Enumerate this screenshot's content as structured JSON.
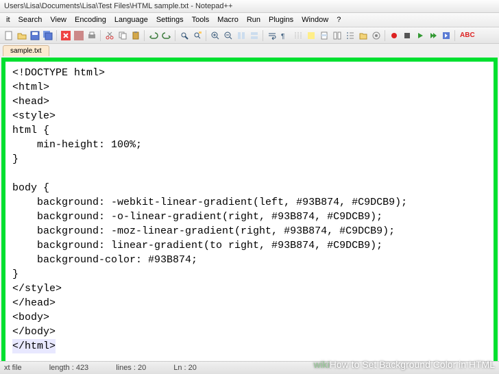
{
  "title": "Users\\Lisa\\Documents\\Lisa\\Test Files\\HTML sample.txt - Notepad++",
  "menu": [
    "it",
    "Search",
    "View",
    "Encoding",
    "Language",
    "Settings",
    "Tools",
    "Macro",
    "Run",
    "Plugins",
    "Window",
    "?"
  ],
  "tab": "sample.txt",
  "code": [
    "<!DOCTYPE html>",
    "<html>",
    "<head>",
    "<style>",
    "html {",
    "    min-height: 100%;",
    "}",
    "",
    "body {",
    "    background: -webkit-linear-gradient(left, #93B874, #C9DCB9);",
    "    background: -o-linear-gradient(right, #93B874, #C9DCB9);",
    "    background: -moz-linear-gradient(right, #93B874, #C9DCB9);",
    "    background: linear-gradient(to right, #93B874, #C9DCB9);",
    "    background-color: #93B874;",
    "}",
    "</style>",
    "</head>",
    "<body>",
    "</body>",
    "</html>"
  ],
  "status": {
    "type": "xt file",
    "length": "length : 423",
    "lines": "lines : 20",
    "ln": "Ln : 20"
  },
  "watermark": {
    "prefix": "wiki",
    "text": "How to Set Background Color in HTML"
  }
}
